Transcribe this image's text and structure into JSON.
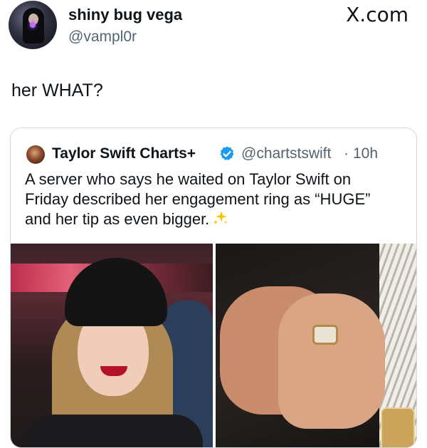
{
  "post": {
    "display_name": "shiny bug vega",
    "handle": "@vampl0r",
    "watermark": "X.com",
    "text": "her WHAT?"
  },
  "quote": {
    "author": "Taylor Swift Charts+",
    "verified_icon": "verified-badge-icon",
    "handle": "@chartstswift",
    "separator": "·",
    "time": "10h",
    "lines": [
      "A server who says he waited on Taylor Swift on",
      "Friday described her engagement ring as “HUGE”",
      "and her tip as even bigger."
    ],
    "emoji": "sparkles-icon"
  },
  "colors": {
    "text": "#0f1419",
    "muted": "#536471",
    "verified": "#1d9bf0",
    "border": "#cfd9de"
  }
}
